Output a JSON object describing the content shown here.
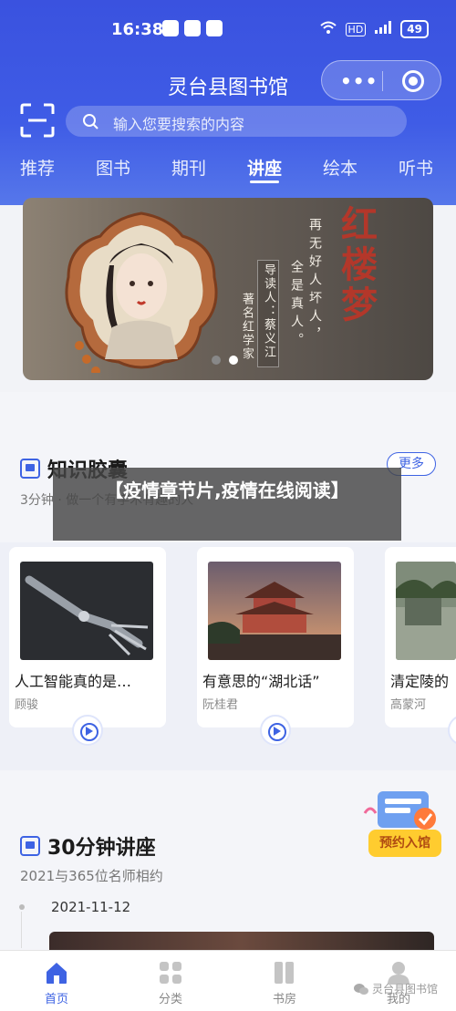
{
  "status_bar": {
    "time": "16:38",
    "battery": "49",
    "signal_label": "HD"
  },
  "app": {
    "title": "灵台县图书馆"
  },
  "capsule": {
    "menu_icon": "more-dots-icon",
    "close_icon": "target-ring-icon"
  },
  "search": {
    "placeholder": "输入您要搜索的内容"
  },
  "tabs": [
    {
      "label": "推荐"
    },
    {
      "label": "图书"
    },
    {
      "label": "期刊"
    },
    {
      "label": "讲座",
      "active": true
    },
    {
      "label": "绘本"
    },
    {
      "label": "听书"
    }
  ],
  "banner": {
    "calligraphy": "红楼梦",
    "lines": [
      "再无好人坏人，",
      "全是真人。"
    ],
    "guide": "导读人：蔡义江",
    "guide_desc": "著名红学家",
    "active_dot": 1
  },
  "knowledge": {
    "title": "知识胶囊",
    "subtitle": "3分钟 · 做一个有学术有趣的人",
    "more": "更多"
  },
  "overlay_text": "【疫情章节片,疫情在线阅读】",
  "cards": [
    {
      "title": "人工智能真的是…",
      "author": "顾骏"
    },
    {
      "title": "有意思的“湖北话”",
      "author": "阮桂君"
    },
    {
      "title": "清定陵的",
      "author": "高蒙河"
    }
  ],
  "lecture": {
    "title": "30分钟讲座",
    "subtitle": "2021与365位名师相约",
    "date": "2021-11-12"
  },
  "reserve": {
    "label": "预约入馆"
  },
  "tabbar": [
    {
      "label": "首页",
      "icon": "home-icon",
      "active": true
    },
    {
      "label": "分类",
      "icon": "grid-icon"
    },
    {
      "label": "书房",
      "icon": "bookshelf-icon"
    },
    {
      "label": "我的",
      "icon": "user-icon"
    }
  ],
  "watermark": "灵台县图书馆",
  "colors": {
    "primary": "#3e63e3",
    "header": "#3a52df",
    "reserve": "#ffcc2f"
  }
}
